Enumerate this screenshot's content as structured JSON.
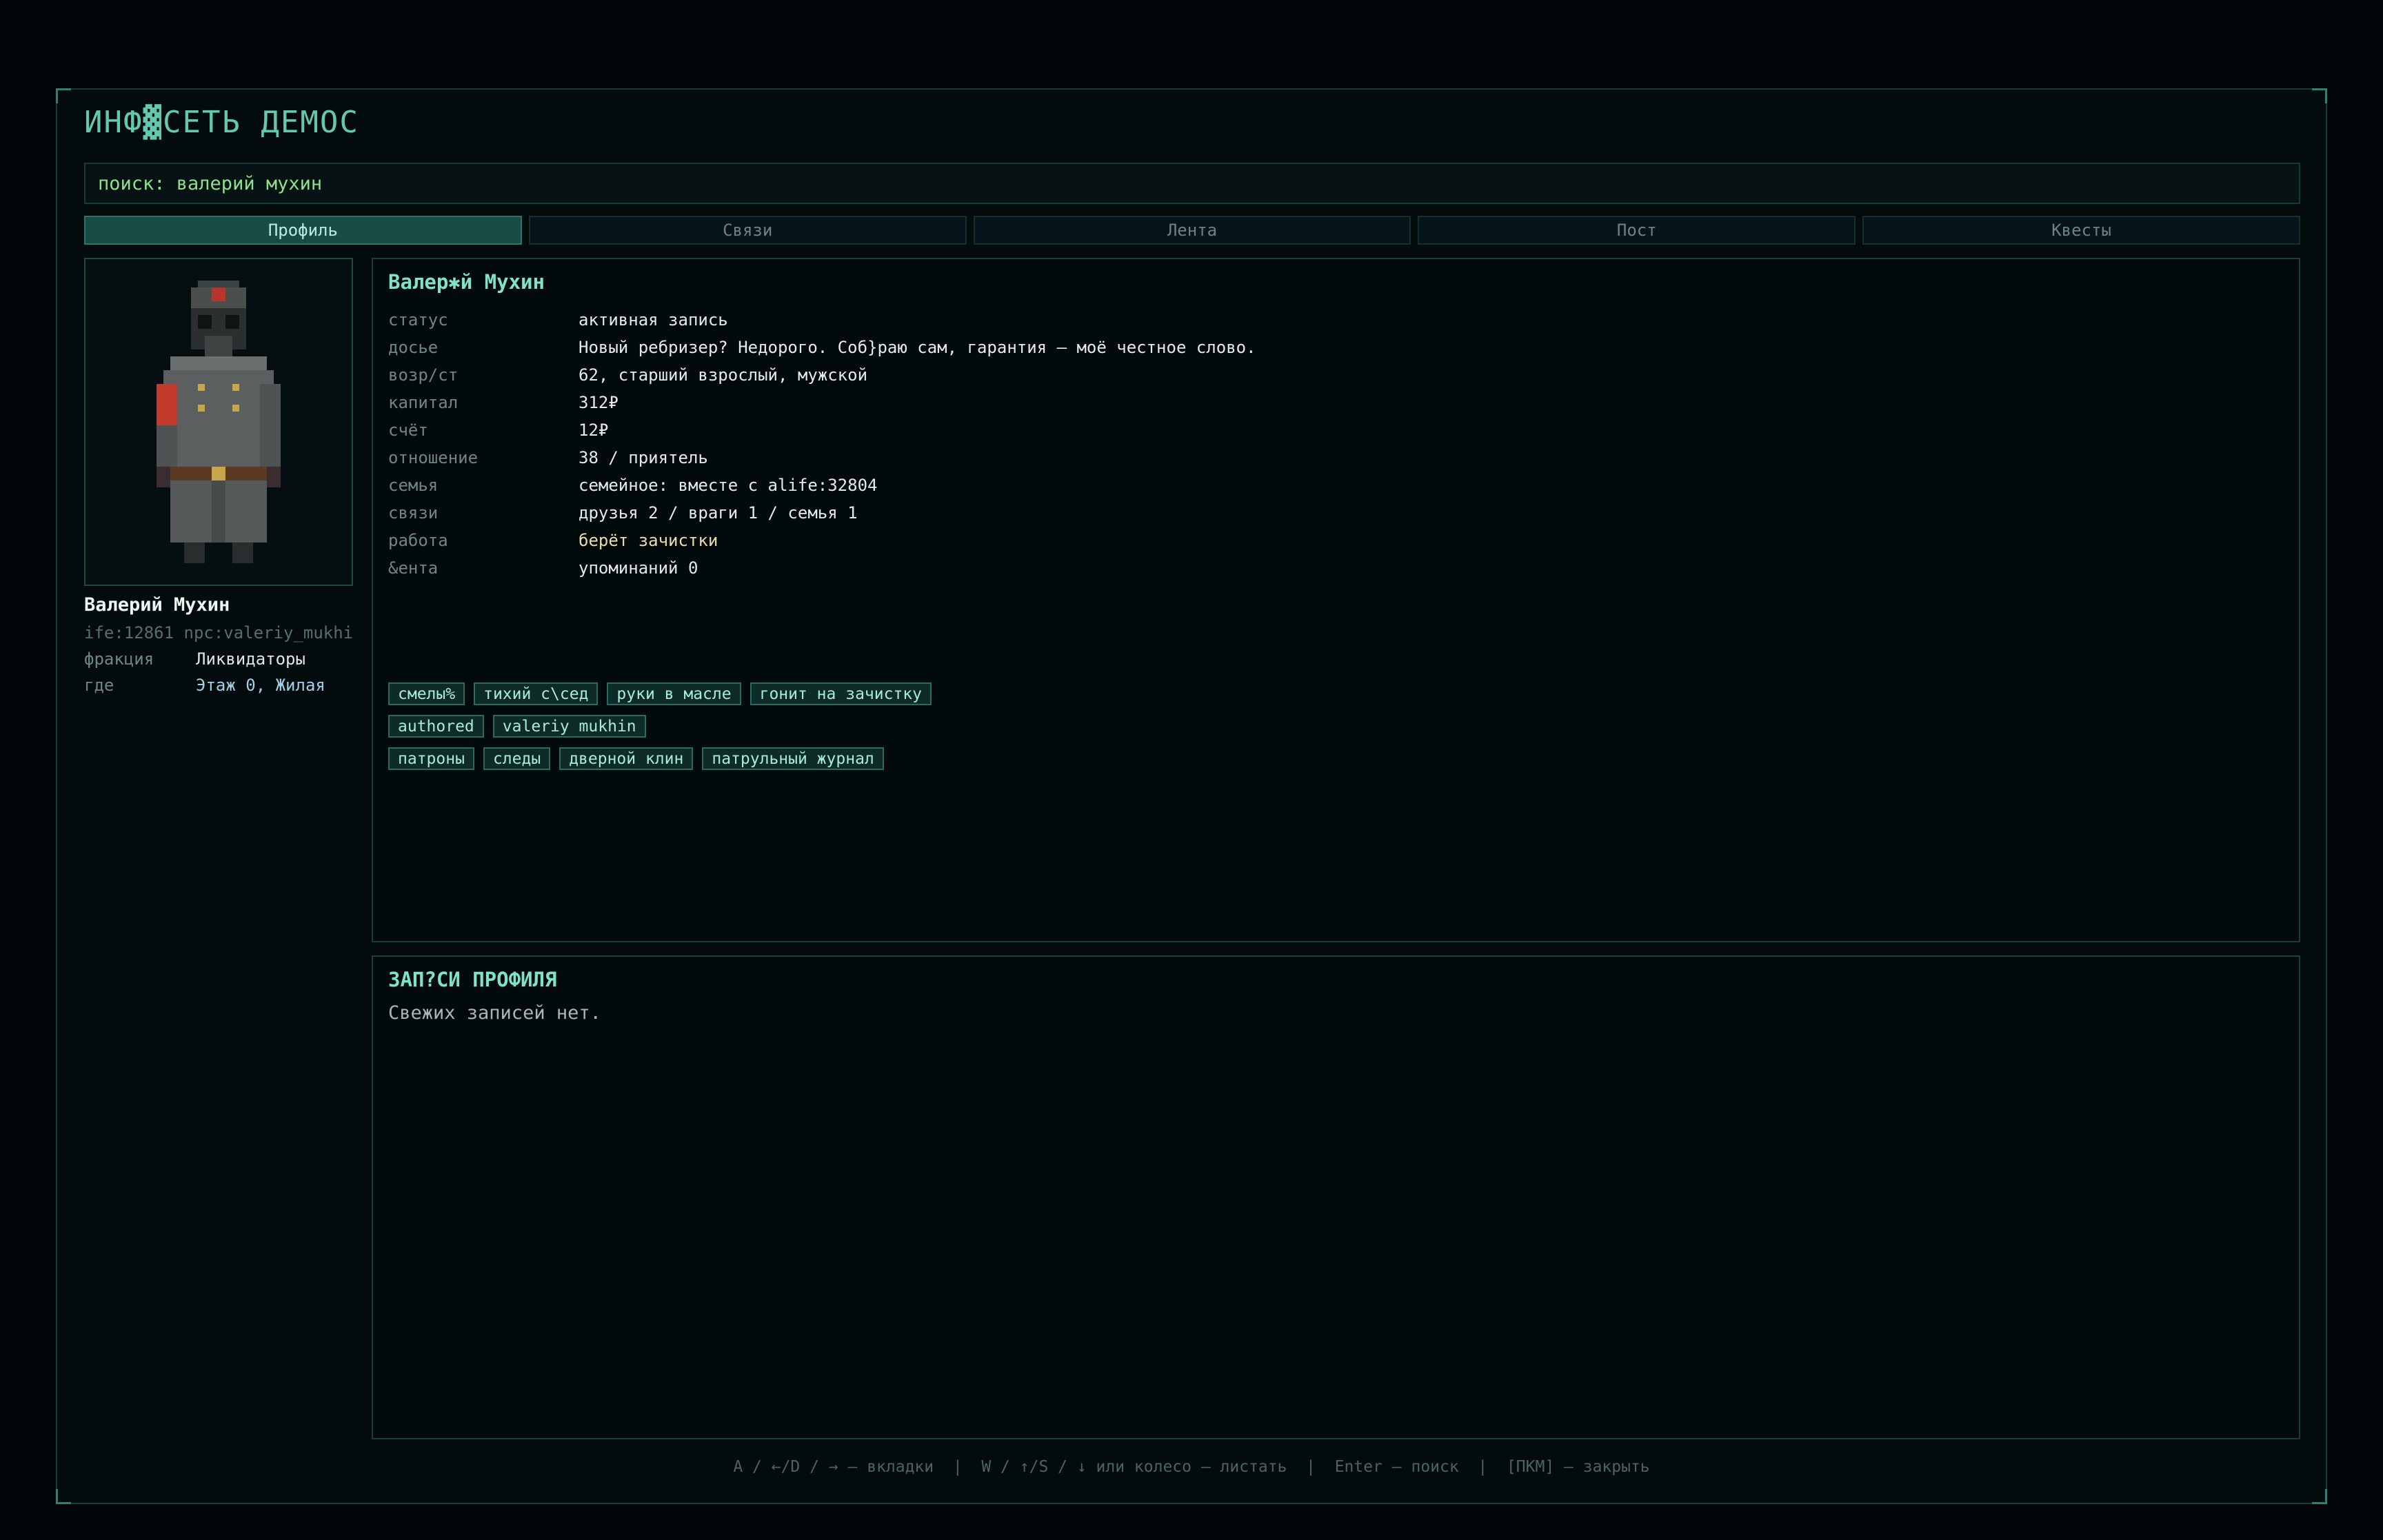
{
  "app": {
    "title": "ИНФ▓СЕТЬ ДЕМОС"
  },
  "search": {
    "text": "поиск: валерий мухин"
  },
  "tabs": [
    {
      "label": "Профиль",
      "active": true
    },
    {
      "label": "Связи",
      "active": false
    },
    {
      "label": "Лента",
      "active": false
    },
    {
      "label": "Пост",
      "active": false
    },
    {
      "label": "Квесты",
      "active": false
    }
  ],
  "sidebar": {
    "name": "Валерий Мухин",
    "id_line": "ife:12861 npc:valeriy_mukhi",
    "faction_label": "фракция",
    "faction_value": "Ликвидаторы",
    "where_label": "где",
    "where_value": "Этаж 0, Жилая",
    "portrait_icon": "soldier-gasmask-portrait"
  },
  "profile": {
    "title": "Валер✱й Мухин",
    "rows": [
      {
        "k": "статус",
        "v": "активная запись"
      },
      {
        "k": "досье",
        "v": "Новый ребризер? Недорого. Соб}раю сам, гарантия — моё честное слово."
      },
      {
        "k": "возр/ст",
        "v": "62, старший взрослый, мужской"
      },
      {
        "k": "капитал",
        "v": "312₽"
      },
      {
        "k": "счёт",
        "v": "12₽"
      },
      {
        "k": "отношение",
        "v": "38 / приятель"
      },
      {
        "k": "семья",
        "v": "семейное: вместе с alife:32804"
      },
      {
        "k": "связи",
        "v": "друзья 2 / враги 1 / семья 1"
      },
      {
        "k": "работа",
        "v": "берёт зачистки"
      },
      {
        "k": "&ента",
        "v": "упоминаний 0"
      }
    ],
    "tags": [
      [
        "смелы%",
        "тихий с\\сед",
        "руки в масле",
        "гонит на зачистку"
      ],
      [
        "authored",
        "valeriy mukhin"
      ],
      [
        "патроны",
        "следы",
        "дверной клин",
        "патрульный журнал"
      ]
    ]
  },
  "notes": {
    "title": "ЗАП?СИ ПРОФИЛЯ",
    "empty": "Свежих записей нет."
  },
  "footer": {
    "hint": "A / ←/D / → — вкладки  |  W / ↑/S / ↓ или колесо — листать  |  Enter — поиск  |  [ПКМ] — закрыть"
  },
  "colors": {
    "accent": "#62c8ae",
    "border": "#163a36",
    "background": "#020608"
  }
}
